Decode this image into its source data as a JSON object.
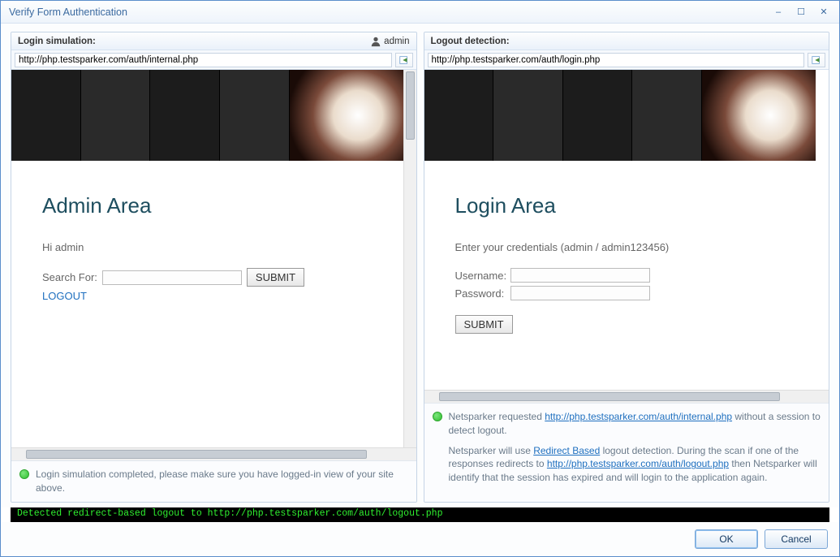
{
  "window": {
    "title": "Verify Form Authentication",
    "controls": {
      "min": "–",
      "max": "☐",
      "close": "✕"
    }
  },
  "left": {
    "header": "Login simulation:",
    "username_label": "admin",
    "url": "http://php.testsparker.com/auth/internal.php",
    "page": {
      "heading": "Admin Area",
      "greeting": "Hi admin",
      "search_label": "Search For:",
      "submit": "SUBMIT",
      "logout": "LOGOUT"
    },
    "status": "Login simulation completed, please make sure you have logged-in view of your site above."
  },
  "right": {
    "header": "Logout detection:",
    "url": "http://php.testsparker.com/auth/login.php",
    "page": {
      "heading": "Login Area",
      "hint": "Enter your credentials (admin / admin123456)",
      "username_label": "Username:",
      "password_label": "Password:",
      "submit": "SUBMIT"
    },
    "status": {
      "p1_a": "Netsparker requested ",
      "p1_link": "http://php.testsparker.com/auth/internal.php",
      "p1_b": "  without a session to detect logout.",
      "p2_a": "Netsparker will use ",
      "p2_link1": "Redirect Based",
      "p2_b": "  logout detection. During the scan if one of the responses redirects to ",
      "p2_link2": "http://php.testsparker.com/auth/logout.php",
      "p2_c": "  then Netsparker will identify that the session has expired and will login to the application again."
    }
  },
  "console": "Detected redirect-based logout to http://php.testsparker.com/auth/logout.php",
  "buttons": {
    "ok": "OK",
    "cancel": "Cancel"
  }
}
